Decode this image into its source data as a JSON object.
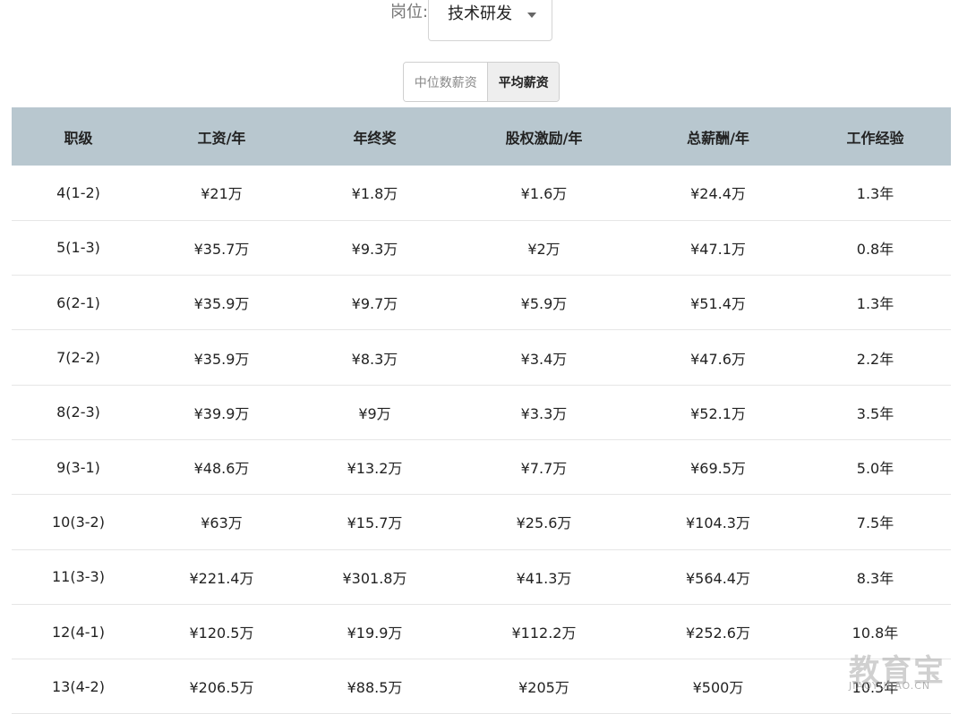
{
  "filter": {
    "label": "岗位:",
    "selected": "技术研发"
  },
  "toggle": {
    "median": "中位数薪资",
    "average": "平均薪资",
    "active": "average"
  },
  "table": {
    "headers": [
      "职级",
      "工资/年",
      "年终奖",
      "股权激励/年",
      "总薪酬/年",
      "工作经验"
    ],
    "rows": [
      [
        "4(1-2)",
        "¥21万",
        "¥1.8万",
        "¥1.6万",
        "¥24.4万",
        "1.3年"
      ],
      [
        "5(1-3)",
        "¥35.7万",
        "¥9.3万",
        "¥2万",
        "¥47.1万",
        "0.8年"
      ],
      [
        "6(2-1)",
        "¥35.9万",
        "¥9.7万",
        "¥5.9万",
        "¥51.4万",
        "1.3年"
      ],
      [
        "7(2-2)",
        "¥35.9万",
        "¥8.3万",
        "¥3.4万",
        "¥47.6万",
        "2.2年"
      ],
      [
        "8(2-3)",
        "¥39.9万",
        "¥9万",
        "¥3.3万",
        "¥52.1万",
        "3.5年"
      ],
      [
        "9(3-1)",
        "¥48.6万",
        "¥13.2万",
        "¥7.7万",
        "¥69.5万",
        "5.0年"
      ],
      [
        "10(3-2)",
        "¥63万",
        "¥15.7万",
        "¥25.6万",
        "¥104.3万",
        "7.5年"
      ],
      [
        "11(3-3)",
        "¥221.4万",
        "¥301.8万",
        "¥41.3万",
        "¥564.4万",
        "8.3年"
      ],
      [
        "12(4-1)",
        "¥120.5万",
        "¥19.9万",
        "¥112.2万",
        "¥252.6万",
        "10.8年"
      ],
      [
        "13(4-2)",
        "¥206.5万",
        "¥88.5万",
        "¥205万",
        "¥500万",
        "10.5年"
      ]
    ]
  },
  "watermark": {
    "main": "教育宝",
    "sub": "JIAOYUBAO.CN"
  },
  "colors": {
    "header_bg": "#b8c7cf",
    "active_toggle_bg": "#eeeeee"
  }
}
